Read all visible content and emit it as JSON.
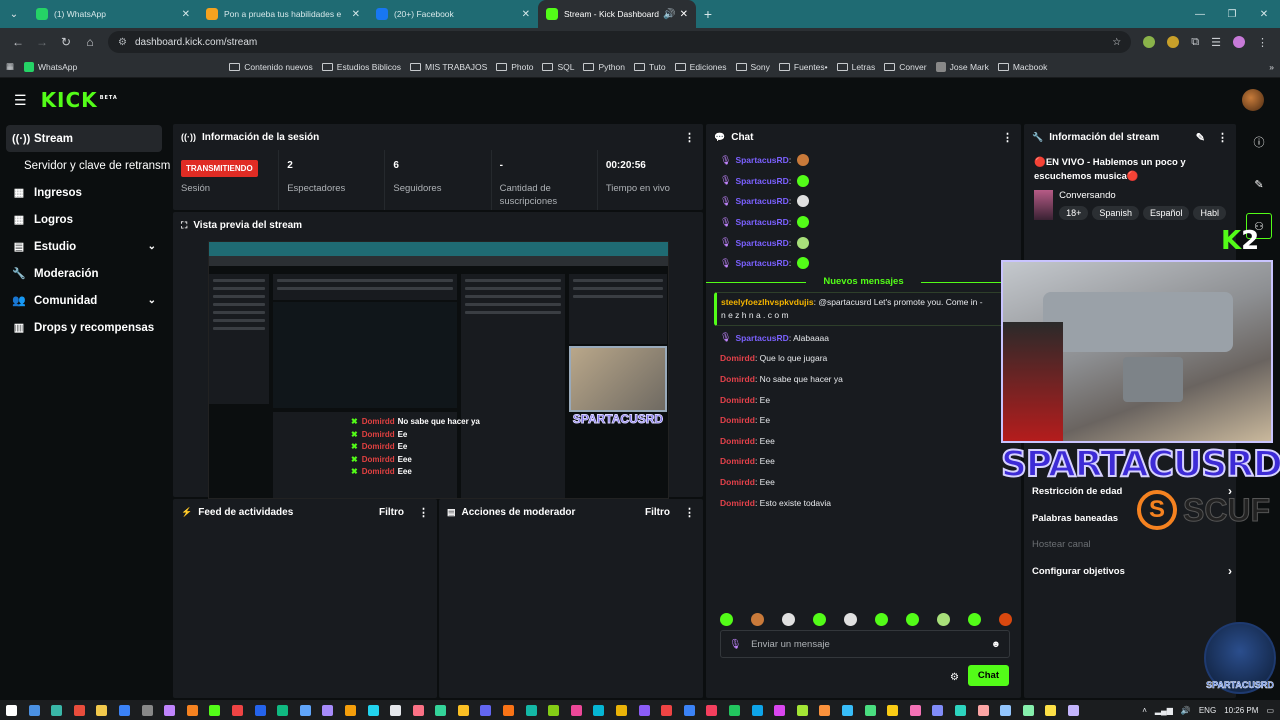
{
  "browser": {
    "tabs": [
      {
        "title": "(1) WhatsApp",
        "color": "#25d366"
      },
      {
        "title": "Pon a prueba tus habilidades e",
        "color": "#f4a21f"
      },
      {
        "title": "(20+) Facebook",
        "color": "#1877f2"
      },
      {
        "title": "Stream - Kick Dashboard",
        "color": "#53fc18",
        "active": true
      }
    ],
    "url": "dashboard.kick.com/stream",
    "bookmarks": [
      {
        "label": "WhatsApp",
        "color": "#25d366",
        "type": "site"
      },
      {
        "label": "Contenido nuevos",
        "type": "folder"
      },
      {
        "label": "Estudios Biblicos",
        "type": "folder"
      },
      {
        "label": "MIS TRABAJOS",
        "type": "folder"
      },
      {
        "label": "Photo",
        "type": "folder"
      },
      {
        "label": "SQL",
        "type": "folder"
      },
      {
        "label": "Python",
        "type": "folder"
      },
      {
        "label": "Tuto",
        "type": "folder"
      },
      {
        "label": "Ediciones",
        "type": "folder"
      },
      {
        "label": "Sony",
        "type": "folder"
      },
      {
        "label": "Fuentes•",
        "type": "folder"
      },
      {
        "label": "Letras",
        "type": "folder"
      },
      {
        "label": "Conver",
        "type": "folder"
      },
      {
        "label": "Jose Mark",
        "type": "site",
        "color": "#888"
      },
      {
        "label": "Macbook",
        "type": "folder"
      }
    ]
  },
  "kick": {
    "logo": "KICK",
    "beta": "BETA",
    "sidebar": [
      {
        "label": "Stream",
        "icon": "broadcast-icon",
        "glyph": "((·))",
        "active": true
      },
      {
        "label": "Servidor y clave de retransm",
        "sub": true
      },
      {
        "label": "Ingresos",
        "icon": "income-icon",
        "glyph": "▦"
      },
      {
        "label": "Logros",
        "icon": "achievements-icon",
        "glyph": "▦"
      },
      {
        "label": "Estudio",
        "icon": "studio-icon",
        "glyph": "▤",
        "chev": true
      },
      {
        "label": "Moderación",
        "icon": "wrench-icon",
        "glyph": "🔧"
      },
      {
        "label": "Comunidad",
        "icon": "community-icon",
        "glyph": "👥",
        "chev": true
      },
      {
        "label": "Drops y recompensas",
        "icon": "drops-icon",
        "glyph": "▥"
      }
    ],
    "session": {
      "title": "Información de la sesión",
      "badge": "TRANSMITIENDO",
      "stats": [
        {
          "value": "",
          "label": "Sesión"
        },
        {
          "value": "2",
          "label": "Espectadores"
        },
        {
          "value": "6",
          "label": "Seguidores"
        },
        {
          "value": "-",
          "label": "Cantidad de suscripciones"
        },
        {
          "value": "00:20:56",
          "label": "Tiempo en vivo"
        }
      ]
    },
    "preview": {
      "title": "Vista previa del stream",
      "overlay_lines": [
        {
          "user": "Domirdd",
          "text": "No sabe que hacer ya"
        },
        {
          "user": "Domirdd",
          "text": "Ee"
        },
        {
          "user": "Domirdd",
          "text": "Ee"
        },
        {
          "user": "Domirdd",
          "text": "Eee"
        },
        {
          "user": "Domirdd",
          "text": "Eee"
        }
      ],
      "mini_name": "SPARTACUSRD"
    },
    "activity": {
      "title": "Feed de actividades",
      "filter": "Filtro"
    },
    "modactions": {
      "title": "Acciones de moderador",
      "filter": "Filtro"
    },
    "chat": {
      "title": "Chat",
      "emote_messages": [
        {
          "user": "SpartacusRD",
          "emote_color": "#c97a3a"
        },
        {
          "user": "SpartacusRD",
          "emote_color": "#53fc18"
        },
        {
          "user": "SpartacusRD",
          "emote_color": "#e0e0e0"
        },
        {
          "user": "SpartacusRD",
          "emote_color": "#53fc18"
        },
        {
          "user": "SpartacusRD",
          "emote_color": "#a8e07a"
        },
        {
          "user": "SpartacusRD",
          "emote_color": "#53fc18"
        }
      ],
      "new_messages_label": "Nuevos mensajes",
      "promo": {
        "user": "steelyfoezlhvspkvdujis",
        "text": ": @spartacusrd Let's promote you. Come in -",
        "text2": "n e z h n a . c o m"
      },
      "messages": [
        {
          "user": "SpartacusRD",
          "text": ": Alabaaaa",
          "red": false
        },
        {
          "user": "Domirdd",
          "text": ": Que lo que jugara",
          "red": true
        },
        {
          "user": "Domirdd",
          "text": ": No sabe que hacer ya",
          "red": true
        },
        {
          "user": "Domirdd",
          "text": ": Ee",
          "red": true
        },
        {
          "user": "Domirdd",
          "text": ": Ee",
          "red": true
        },
        {
          "user": "Domirdd",
          "text": ": Eee",
          "red": true
        },
        {
          "user": "Domirdd",
          "text": ": Eee",
          "red": true
        },
        {
          "user": "Domirdd",
          "text": ": Eee",
          "red": true
        },
        {
          "user": "Domirdd",
          "text": ": Esto existe todavia",
          "red": true
        }
      ],
      "emote_bar": [
        "#53fc18",
        "#c97a3a",
        "#e0e0e0",
        "#53fc18",
        "#e0e0e0",
        "#53fc18",
        "#53fc18",
        "#a8e07a",
        "#53fc18",
        "#d9480f"
      ],
      "input_placeholder": "Enviar un mensaje",
      "send_label": "Chat"
    },
    "stream_info": {
      "title": "Información del stream",
      "stream_title": "🔴EN VIVO - Hablemos un poco y escuchemos musica🔴",
      "category": "Conversando",
      "tags": [
        "18+",
        "Spanish",
        "Español",
        "Habl"
      ],
      "rows": [
        {
          "label": "Restricción de edad",
          "chev": true,
          "disabled": false
        },
        {
          "label": "Palabras baneadas",
          "chev": false,
          "disabled": false
        },
        {
          "label": "Hostear canal",
          "chev": false,
          "disabled": true
        },
        {
          "label": "Configurar objetivos",
          "chev": true,
          "disabled": false
        }
      ]
    },
    "overlay": {
      "cam_name": "SPARTACUSRD",
      "sponsor": "SCUF",
      "k2_k": "K",
      "k2_2": "2",
      "mascot_label": "SPARTACUSRD"
    }
  },
  "taskbar": {
    "lang": "ENG",
    "time": "10:26 PM"
  }
}
